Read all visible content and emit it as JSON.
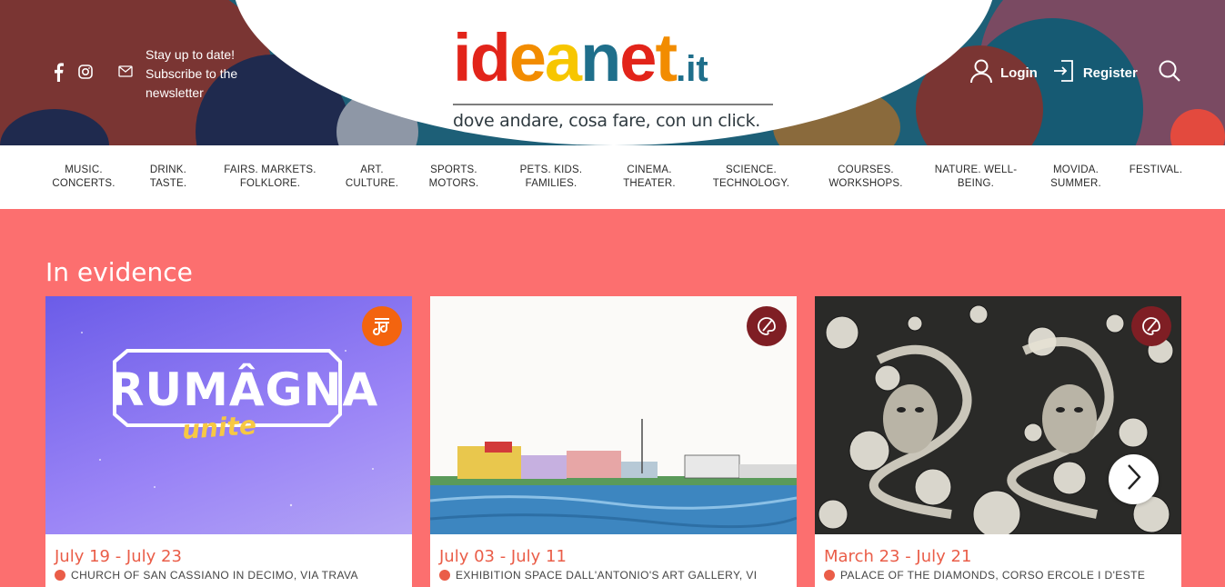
{
  "header": {
    "subscribe_text": "Stay up to date! Subscribe to the newsletter",
    "logo": {
      "letters": [
        {
          "char": "i",
          "color": "#e2241a"
        },
        {
          "char": "d",
          "color": "#e2241a"
        },
        {
          "char": "e",
          "color": "#f28c00"
        },
        {
          "char": "a",
          "color": "#f7c600"
        },
        {
          "char": "n",
          "color": "#1f6f8b"
        },
        {
          "char": "e",
          "color": "#e2241a"
        },
        {
          "char": "t",
          "color": "#f28c00"
        }
      ],
      "suffix": ".it",
      "suffix_color": "#1f6f8b",
      "tagline": "dove andare, cosa fare, con un click."
    },
    "login_label": "Login",
    "register_label": "Register",
    "icons": [
      "facebook-icon",
      "instagram-icon",
      "mail-icon",
      "user-icon",
      "sign-in-icon",
      "search-icon"
    ]
  },
  "nav": {
    "items": [
      {
        "line1": "MUSIC.",
        "line2": "CONCERTS."
      },
      {
        "line1": "DRINK.",
        "line2": "TASTE."
      },
      {
        "line1": "FAIRS. MARKETS.",
        "line2": "FOLKLORE."
      },
      {
        "line1": "ART.",
        "line2": "CULTURE."
      },
      {
        "line1": "SPORTS.",
        "line2": "MOTORS."
      },
      {
        "line1": "PETS. KIDS.",
        "line2": "FAMILIES."
      },
      {
        "line1": "CINEMA.",
        "line2": "THEATER."
      },
      {
        "line1": "SCIENCE.",
        "line2": "TECHNOLOGY."
      },
      {
        "line1": "COURSES.",
        "line2": "WORKSHOPS."
      },
      {
        "line1": "NATURE. WELL-",
        "line2": "BEING."
      },
      {
        "line1": "MOVIDA.",
        "line2": "SUMMER."
      },
      {
        "line1": "FESTIVAL.",
        "line2": ""
      }
    ]
  },
  "main": {
    "section_title": "In evidence",
    "cards": [
      {
        "image_text_main": "RUMÂGNA",
        "image_text_sub": "unite",
        "date": "July 19 - July 23",
        "location": "CHURCH OF SAN CASSIANO IN DECIMO, VIA TRAVA",
        "badge_icon": "music-note-icon",
        "badge_color": "#f3640f"
      },
      {
        "date": "July 03 - July 11",
        "location": "EXHIBITION SPACE DALL'ANTONIO'S ART GALLERY, VI",
        "badge_icon": "palette-icon",
        "badge_color": "#7f1e24"
      },
      {
        "date": "March 23 - July 21",
        "location": "PALACE OF THE DIAMONDS, CORSO ERCOLE I D'ESTE",
        "badge_icon": "palette-icon",
        "badge_color": "#7f1e24"
      }
    ],
    "next_icon": "chevron-right-icon"
  }
}
